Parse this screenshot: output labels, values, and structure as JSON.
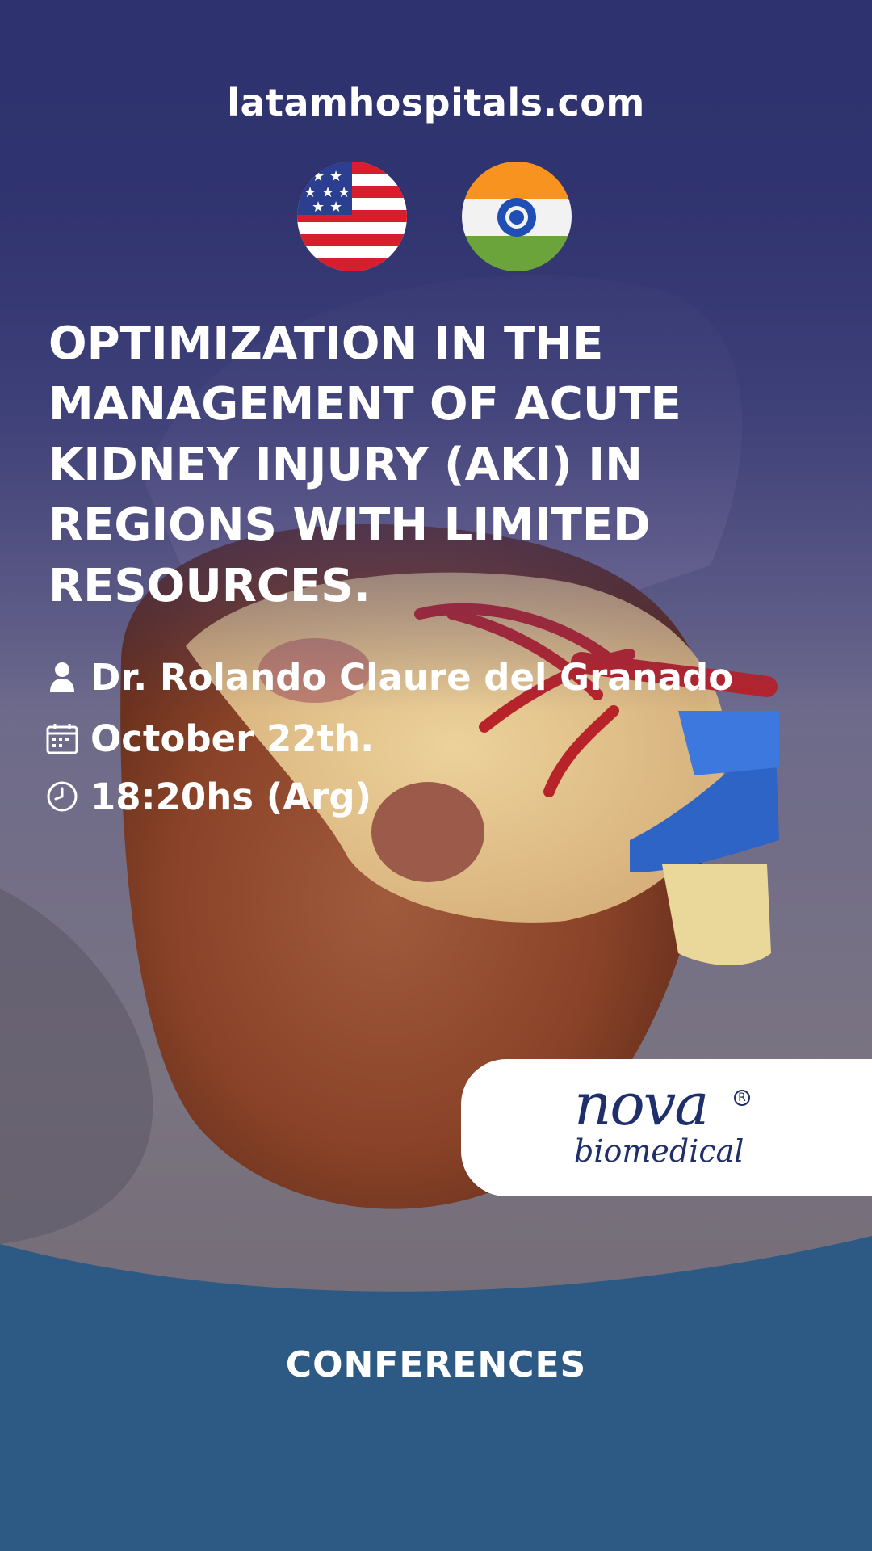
{
  "site": {
    "url": "latamhospitals.com"
  },
  "flags": [
    {
      "name": "United States",
      "icon": "us-flag-icon"
    },
    {
      "name": "India",
      "icon": "india-flag-icon"
    }
  ],
  "event": {
    "title_lines": [
      "OPTIMIZATION IN THE",
      "MANAGEMENT OF ACUTE",
      "KIDNEY INJURY (AKI) IN",
      "REGIONS WITH LIMITED",
      "RESOURCES."
    ],
    "speaker": "Dr. Rolando Claure del Granado",
    "date": "October 22th.",
    "time": "18:20hs (Arg)"
  },
  "sponsor": {
    "logo_word": "nova",
    "logo_subword": "biomedical",
    "logo_registered": "R"
  },
  "footer": {
    "label": "CONFERENCES"
  },
  "colors": {
    "header_navy": "#2e326e",
    "footer_blue": "#2d5a84",
    "logo_navy": "#1f2f6b",
    "text_white": "#ffffff"
  },
  "icons": {
    "speaker": "person-icon",
    "date": "calendar-icon",
    "time": "clock-icon"
  }
}
